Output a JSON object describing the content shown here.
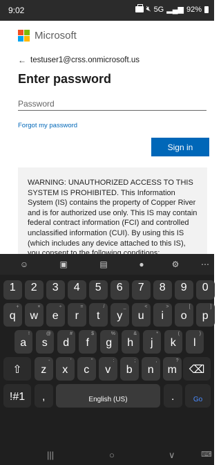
{
  "status_bar": {
    "time": "9:02",
    "network": "5G",
    "battery": "92%"
  },
  "header": {
    "brand": "Microsoft",
    "colors": {
      "red": "#f25022",
      "green": "#7fba00",
      "blue": "#00a4ef",
      "yellow": "#ffb900"
    }
  },
  "account": {
    "email": "testuser1@crss.onmicrosoft.us"
  },
  "form": {
    "title": "Enter password",
    "password_placeholder": "Password",
    "password_value": "",
    "forgot_link": "Forgot my password",
    "signin_label": "Sign in"
  },
  "warning": {
    "text": "WARNING: UNAUTHORIZED ACCESS TO THIS SYSTEM IS PROHIBITED. This Information System (IS) contains the property of Copper River and is for authorized use only. This IS may contain federal contract information (FCI) and controlled unclassified information (CUI). By using this IS (which includes any device attached to this IS), you consent to the following conditions:"
  },
  "keyboard": {
    "toolbar_icons": [
      "emoji-icon",
      "clipboard-icon",
      "text-icon",
      "mic-icon",
      "settings-icon",
      "more-icon"
    ],
    "number_row": [
      "1",
      "2",
      "3",
      "4",
      "5",
      "6",
      "7",
      "8",
      "9",
      "0"
    ],
    "row1": [
      {
        "k": "q",
        "s": "+"
      },
      {
        "k": "w",
        "s": "×"
      },
      {
        "k": "e",
        "s": "÷"
      },
      {
        "k": "r",
        "s": "="
      },
      {
        "k": "t",
        "s": "/"
      },
      {
        "k": "y",
        "s": "_"
      },
      {
        "k": "u",
        "s": "<"
      },
      {
        "k": "i",
        "s": ">"
      },
      {
        "k": "o",
        "s": "["
      },
      {
        "k": "p",
        "s": "]"
      }
    ],
    "row2": [
      {
        "k": "a",
        "s": "!"
      },
      {
        "k": "s",
        "s": "@"
      },
      {
        "k": "d",
        "s": "#"
      },
      {
        "k": "f",
        "s": "$"
      },
      {
        "k": "g",
        "s": "%"
      },
      {
        "k": "h",
        "s": "&"
      },
      {
        "k": "j",
        "s": "*"
      },
      {
        "k": "k",
        "s": "("
      },
      {
        "k": "l",
        "s": ")"
      }
    ],
    "row3": [
      {
        "k": "z",
        "s": "-"
      },
      {
        "k": "x",
        "s": "'"
      },
      {
        "k": "c",
        "s": "\""
      },
      {
        "k": "v",
        "s": ":"
      },
      {
        "k": "b",
        "s": ";"
      },
      {
        "k": "n",
        "s": ","
      },
      {
        "k": "m",
        "s": "?"
      }
    ],
    "symbols_label": "!#1",
    "comma_label": ",",
    "space_label": "English (US)",
    "period_label": ".",
    "go_label": "Go"
  },
  "nav": {
    "recents": "|||",
    "home": "○",
    "back": "∨",
    "keyboard": "⌨"
  }
}
